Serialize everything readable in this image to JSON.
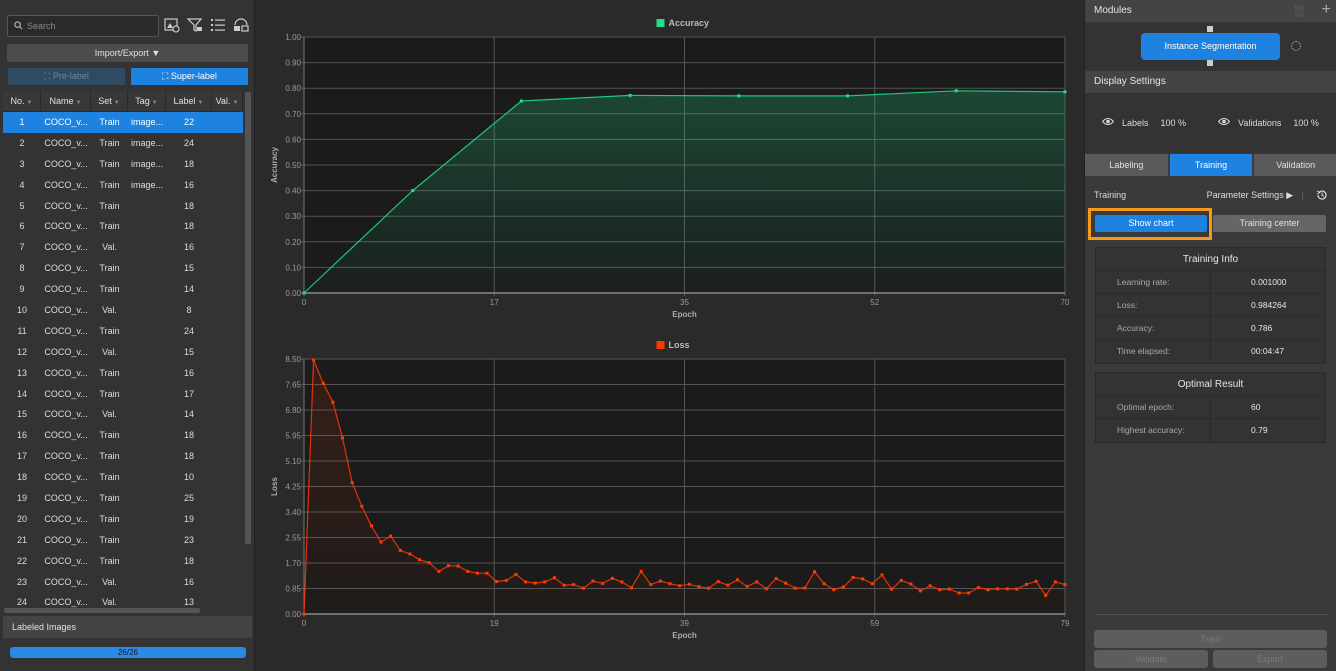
{
  "left_panel": {
    "search": {
      "placeholder": "Search",
      "value": ""
    },
    "toolbar_icons": [
      "image-settings-icon",
      "filter-icon",
      "list-view-icon",
      "layout-icon"
    ],
    "import_export_label": "Import/Export",
    "pre_label": "Pre-label",
    "super_label": "Super-label",
    "table": {
      "columns": [
        "No.",
        "Name",
        "Set",
        "Tag",
        "Label",
        "Val."
      ],
      "selected_row": 1,
      "rows": [
        {
          "no": "1",
          "name": "COCO_v...",
          "set": "Train",
          "tag": "image...",
          "label": "22",
          "val": ""
        },
        {
          "no": "2",
          "name": "COCO_v...",
          "set": "Train",
          "tag": "image...",
          "label": "24",
          "val": ""
        },
        {
          "no": "3",
          "name": "COCO_v...",
          "set": "Train",
          "tag": "image...",
          "label": "18",
          "val": ""
        },
        {
          "no": "4",
          "name": "COCO_v...",
          "set": "Train",
          "tag": "image...",
          "label": "16",
          "val": ""
        },
        {
          "no": "5",
          "name": "COCO_v...",
          "set": "Train",
          "tag": "",
          "label": "18",
          "val": ""
        },
        {
          "no": "6",
          "name": "COCO_v...",
          "set": "Train",
          "tag": "",
          "label": "18",
          "val": ""
        },
        {
          "no": "7",
          "name": "COCO_v...",
          "set": "Val.",
          "tag": "",
          "label": "16",
          "val": ""
        },
        {
          "no": "8",
          "name": "COCO_v...",
          "set": "Train",
          "tag": "",
          "label": "15",
          "val": ""
        },
        {
          "no": "9",
          "name": "COCO_v...",
          "set": "Train",
          "tag": "",
          "label": "14",
          "val": ""
        },
        {
          "no": "10",
          "name": "COCO_v...",
          "set": "Val.",
          "tag": "",
          "label": "8",
          "val": ""
        },
        {
          "no": "11",
          "name": "COCO_v...",
          "set": "Train",
          "tag": "",
          "label": "24",
          "val": ""
        },
        {
          "no": "12",
          "name": "COCO_v...",
          "set": "Val.",
          "tag": "",
          "label": "15",
          "val": ""
        },
        {
          "no": "13",
          "name": "COCO_v...",
          "set": "Train",
          "tag": "",
          "label": "16",
          "val": ""
        },
        {
          "no": "14",
          "name": "COCO_v...",
          "set": "Train",
          "tag": "",
          "label": "17",
          "val": ""
        },
        {
          "no": "15",
          "name": "COCO_v...",
          "set": "Val.",
          "tag": "",
          "label": "14",
          "val": ""
        },
        {
          "no": "16",
          "name": "COCO_v...",
          "set": "Train",
          "tag": "",
          "label": "18",
          "val": ""
        },
        {
          "no": "17",
          "name": "COCO_v...",
          "set": "Train",
          "tag": "",
          "label": "18",
          "val": ""
        },
        {
          "no": "18",
          "name": "COCO_v...",
          "set": "Train",
          "tag": "",
          "label": "10",
          "val": ""
        },
        {
          "no": "19",
          "name": "COCO_v...",
          "set": "Train",
          "tag": "",
          "label": "25",
          "val": ""
        },
        {
          "no": "20",
          "name": "COCO_v...",
          "set": "Train",
          "tag": "",
          "label": "19",
          "val": ""
        },
        {
          "no": "21",
          "name": "COCO_v...",
          "set": "Train",
          "tag": "",
          "label": "23",
          "val": ""
        },
        {
          "no": "22",
          "name": "COCO_v...",
          "set": "Train",
          "tag": "",
          "label": "18",
          "val": ""
        },
        {
          "no": "23",
          "name": "COCO_v...",
          "set": "Val.",
          "tag": "",
          "label": "16",
          "val": ""
        },
        {
          "no": "24",
          "name": "COCO_v...",
          "set": "Val.",
          "tag": "",
          "label": "13",
          "val": ""
        }
      ]
    },
    "labeled_images": {
      "title": "Labeled Images",
      "progress_text": "26/26",
      "progress_fraction": 1.0
    }
  },
  "chart_data": [
    {
      "type": "area",
      "title": "Accuracy",
      "legend": "Accuracy",
      "legend_position": "top-center",
      "color": "#1ee08a",
      "xlabel": "Epoch",
      "ylabel": "Accuracy",
      "xlim": [
        0,
        70
      ],
      "ylim": [
        0,
        1.0
      ],
      "x_ticks": [
        "0",
        "17",
        "35",
        "52",
        "70"
      ],
      "y_ticks": [
        "0.00",
        "0.10",
        "0.20",
        "0.30",
        "0.40",
        "0.50",
        "0.60",
        "0.70",
        "0.80",
        "0.90",
        "1.00"
      ],
      "grid": true,
      "x": [
        0,
        10,
        20,
        30,
        40,
        50,
        60,
        70
      ],
      "values": [
        0.0,
        0.4,
        0.75,
        0.772,
        0.77,
        0.77,
        0.79,
        0.786
      ]
    },
    {
      "type": "area",
      "title": "Loss",
      "legend": "Loss",
      "legend_position": "top-center",
      "color": "#ff3a00",
      "xlabel": "Epoch",
      "ylabel": "Loss",
      "xlim": [
        0,
        79
      ],
      "ylim": [
        0,
        8.5
      ],
      "x_ticks": [
        "0",
        "19",
        "39",
        "59",
        "79"
      ],
      "y_ticks": [
        "0.00",
        "0.85",
        "1.70",
        "2.55",
        "3.40",
        "4.25",
        "5.10",
        "5.95",
        "6.80",
        "7.65",
        "8.50"
      ],
      "grid": true,
      "x": [
        0,
        1,
        2,
        3,
        4,
        5,
        6,
        7,
        8,
        9,
        10,
        11,
        12,
        13,
        14,
        15,
        16,
        17,
        18,
        19,
        20,
        21,
        22,
        23,
        24,
        25,
        26,
        27,
        28,
        29,
        30,
        31,
        32,
        33,
        34,
        35,
        36,
        37,
        38,
        39,
        40,
        41,
        42,
        43,
        44,
        45,
        46,
        47,
        48,
        49,
        50,
        51,
        52,
        53,
        54,
        55,
        56,
        57,
        58,
        59,
        60,
        61,
        62,
        63,
        64,
        65,
        66,
        67,
        68,
        69,
        70,
        71,
        72,
        73,
        74,
        75,
        76,
        77,
        78,
        79
      ],
      "values": [
        0.0,
        8.47,
        7.69,
        7.06,
        5.87,
        4.38,
        3.59,
        2.94,
        2.4,
        2.6,
        2.12,
        2.0,
        1.81,
        1.71,
        1.42,
        1.61,
        1.6,
        1.42,
        1.36,
        1.36,
        1.08,
        1.12,
        1.32,
        1.07,
        1.03,
        1.07,
        1.21,
        0.96,
        0.98,
        0.86,
        1.1,
        1.02,
        1.19,
        1.07,
        0.87,
        1.42,
        0.98,
        1.1,
        1.01,
        0.94,
        0.99,
        0.91,
        0.86,
        1.08,
        0.96,
        1.14,
        0.92,
        1.07,
        0.84,
        1.18,
        1.03,
        0.86,
        0.87,
        1.41,
        1.01,
        0.81,
        0.9,
        1.22,
        1.17,
        1.01,
        1.3,
        0.83,
        1.12,
        1.0,
        0.77,
        0.94,
        0.81,
        0.83,
        0.7,
        0.7,
        0.88,
        0.81,
        0.84,
        0.84,
        0.83,
        0.99,
        1.09,
        0.62,
        1.07,
        0.98
      ]
    }
  ],
  "right_panel": {
    "modules_title": "Modules",
    "module_name": "Instance Segmentation",
    "display_settings_title": "Display Settings",
    "labels_label": "Labels",
    "labels_pct": "100 %",
    "validations_label": "Validations",
    "validations_pct": "100 %",
    "tabs": [
      {
        "label": "Labeling",
        "active": false
      },
      {
        "label": "Training",
        "active": true
      },
      {
        "label": "Validation",
        "active": false
      }
    ],
    "training_label": "Training",
    "parameter_settings": "Parameter Settings",
    "show_chart": "Show chart",
    "training_center": "Training center",
    "training_info": {
      "title": "Training Info",
      "rows": [
        {
          "k": "Learning rate:",
          "v": "0.001000"
        },
        {
          "k": "Loss:",
          "v": "0.984264"
        },
        {
          "k": "Accuracy:",
          "v": "0.786"
        },
        {
          "k": "Time elapsed:",
          "v": "00:04:47"
        }
      ]
    },
    "optimal_result": {
      "title": "Optimal Result",
      "rows": [
        {
          "k": "Optimal epoch:",
          "v": "60"
        },
        {
          "k": "Highest accuracy:",
          "v": "0.79"
        }
      ]
    },
    "train_button": "Train",
    "validate_button": "Validate",
    "export_button": "Export",
    "accent_color": "#1e82e0",
    "highlight_color": "#f59a1b"
  }
}
